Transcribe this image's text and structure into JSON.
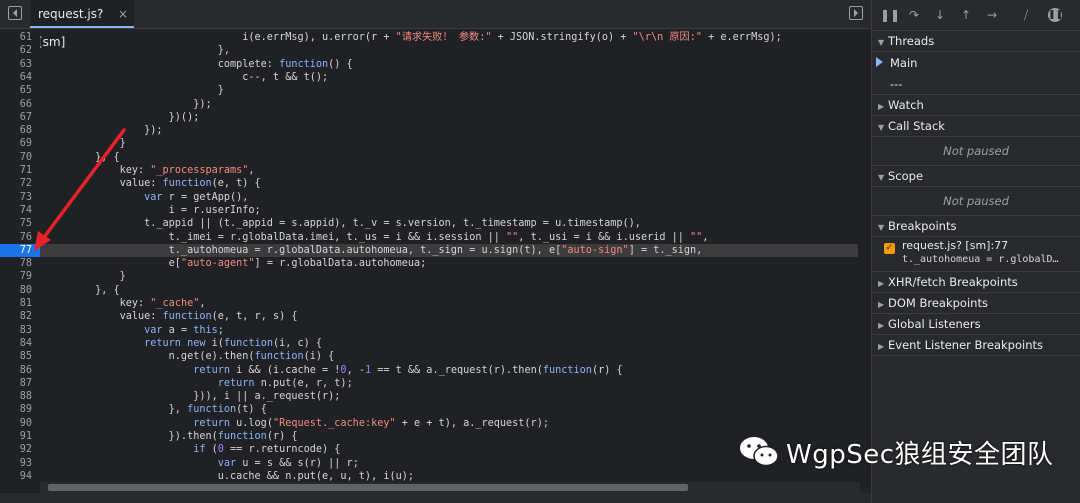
{
  "editor": {
    "tab_label": "request.js? [sm]",
    "close_label": "×",
    "breakpoint_line": "77"
  },
  "code_lines": [
    {
      "n": "61",
      "parts": [
        [
          "",
          "                                i(e.errMsg), u.error(r + "
        ],
        [
          "str",
          "\"请求失败！ 参数:\""
        ],
        [
          "",
          " + JSON.stringify(o) + "
        ],
        [
          "str",
          "\"\\r\\n 原因:\""
        ],
        [
          "",
          " + e.errMsg);"
        ]
      ]
    },
    {
      "n": "62",
      "parts": [
        [
          "",
          "                            },"
        ]
      ]
    },
    {
      "n": "63",
      "parts": [
        [
          "",
          "                            complete: "
        ],
        [
          "kw",
          "function"
        ],
        [
          "",
          "() {"
        ]
      ]
    },
    {
      "n": "64",
      "parts": [
        [
          "",
          "                                c--, t && t();"
        ]
      ]
    },
    {
      "n": "65",
      "parts": [
        [
          "",
          "                            }"
        ]
      ]
    },
    {
      "n": "66",
      "parts": [
        [
          "",
          "                        });"
        ]
      ]
    },
    {
      "n": "67",
      "parts": [
        [
          "",
          "                    })();"
        ]
      ]
    },
    {
      "n": "68",
      "parts": [
        [
          "",
          "                });"
        ]
      ]
    },
    {
      "n": "69",
      "parts": [
        [
          "",
          "            }"
        ]
      ]
    },
    {
      "n": "70",
      "parts": [
        [
          "",
          "        }, {"
        ]
      ]
    },
    {
      "n": "71",
      "parts": [
        [
          "",
          "            key: "
        ],
        [
          "str",
          "\"_processparams\""
        ],
        [
          "",
          ","
        ]
      ]
    },
    {
      "n": "72",
      "parts": [
        [
          "",
          "            value: "
        ],
        [
          "kw",
          "function"
        ],
        [
          "",
          "(e, t) {"
        ]
      ]
    },
    {
      "n": "73",
      "parts": [
        [
          "",
          "                "
        ],
        [
          "kw",
          "var"
        ],
        [
          "",
          " r = getApp(),"
        ]
      ]
    },
    {
      "n": "74",
      "parts": [
        [
          "",
          "                    i = r.userInfo;"
        ]
      ]
    },
    {
      "n": "75",
      "parts": [
        [
          "",
          "                t._appid || (t._appid = s.appid), t._v = s.version, t._timestamp = u.timestamp(),"
        ]
      ]
    },
    {
      "n": "76",
      "parts": [
        [
          "",
          "                    t._imei = r.globalData.imei, t._us = i && i.session || "
        ],
        [
          "str",
          "\"\""
        ],
        [
          "",
          ", t._usi = i && i.userid || "
        ],
        [
          "str",
          "\"\""
        ],
        [
          "",
          ","
        ]
      ]
    },
    {
      "n": "77",
      "parts": [
        [
          "",
          "                    t._autohomeua = r.globalData.autohomeua, t._sign = u.sign(t), e["
        ],
        [
          "str",
          "\"auto-sign\""
        ],
        [
          "",
          "] = t._sign,"
        ]
      ]
    },
    {
      "n": "78",
      "parts": [
        [
          "",
          "                    e["
        ],
        [
          "str",
          "\"auto-agent\""
        ],
        [
          "",
          "] = r.globalData.autohomeua;"
        ]
      ]
    },
    {
      "n": "79",
      "parts": [
        [
          "",
          "            }"
        ]
      ]
    },
    {
      "n": "80",
      "parts": [
        [
          "",
          "        }, {"
        ]
      ]
    },
    {
      "n": "81",
      "parts": [
        [
          "",
          "            key: "
        ],
        [
          "str",
          "\"_cache\""
        ],
        [
          "",
          ","
        ]
      ]
    },
    {
      "n": "82",
      "parts": [
        [
          "",
          "            value: "
        ],
        [
          "kw",
          "function"
        ],
        [
          "",
          "(e, t, r, s) {"
        ]
      ]
    },
    {
      "n": "83",
      "parts": [
        [
          "",
          "                "
        ],
        [
          "kw",
          "var"
        ],
        [
          "",
          " a = "
        ],
        [
          "kw",
          "this"
        ],
        [
          "",
          ";"
        ]
      ]
    },
    {
      "n": "84",
      "parts": [
        [
          "",
          "                "
        ],
        [
          "kw",
          "return"
        ],
        [
          "",
          " "
        ],
        [
          "kw",
          "new"
        ],
        [
          "",
          " i("
        ],
        [
          "kw",
          "function"
        ],
        [
          "",
          "(i, c) {"
        ]
      ]
    },
    {
      "n": "85",
      "parts": [
        [
          "",
          "                    n.get(e).then("
        ],
        [
          "kw",
          "function"
        ],
        [
          "",
          "(i) {"
        ]
      ]
    },
    {
      "n": "86",
      "parts": [
        [
          "",
          "                        "
        ],
        [
          "kw",
          "return"
        ],
        [
          "",
          " i && (i.cache = !"
        ],
        [
          "num",
          "0"
        ],
        [
          "",
          ", -"
        ],
        [
          "num",
          "1"
        ],
        [
          "",
          " == t && a._request(r).then("
        ],
        [
          "kw",
          "function"
        ],
        [
          "",
          "(r) {"
        ]
      ]
    },
    {
      "n": "87",
      "parts": [
        [
          "",
          "                            "
        ],
        [
          "kw",
          "return"
        ],
        [
          "",
          " n.put(e, r, t);"
        ]
      ]
    },
    {
      "n": "88",
      "parts": [
        [
          "",
          "                        })), i || a._request(r);"
        ]
      ]
    },
    {
      "n": "89",
      "parts": [
        [
          "",
          "                    }, "
        ],
        [
          "kw",
          "function"
        ],
        [
          "",
          "(t) {"
        ]
      ]
    },
    {
      "n": "90",
      "parts": [
        [
          "",
          "                        "
        ],
        [
          "kw",
          "return"
        ],
        [
          "",
          " u.log("
        ],
        [
          "str",
          "\"Request._cache:key\""
        ],
        [
          "",
          " + e + t), a._request(r);"
        ]
      ]
    },
    {
      "n": "91",
      "parts": [
        [
          "",
          "                    }).then("
        ],
        [
          "kw",
          "function"
        ],
        [
          "",
          "(r) {"
        ]
      ]
    },
    {
      "n": "92",
      "parts": [
        [
          "",
          "                        "
        ],
        [
          "kw",
          "if"
        ],
        [
          "",
          " ("
        ],
        [
          "num",
          "0"
        ],
        [
          "",
          " == r.returncode) {"
        ]
      ]
    },
    {
      "n": "93",
      "parts": [
        [
          "",
          "                            "
        ],
        [
          "kw",
          "var"
        ],
        [
          "",
          " u = s && s(r) || r;"
        ]
      ]
    },
    {
      "n": "94",
      "parts": [
        [
          "",
          "                            u.cache && n.put(e, u, t), i(u);"
        ]
      ]
    }
  ],
  "sidebar": {
    "threads": {
      "title": "Threads",
      "main": "Main",
      "other": "---"
    },
    "watch": {
      "title": "Watch"
    },
    "call_stack": {
      "title": "Call Stack",
      "empty": "Not paused"
    },
    "scope": {
      "title": "Scope",
      "empty": "Not paused"
    },
    "breakpoints": {
      "title": "Breakpoints",
      "item_name": "request.js? [sm]:77",
      "item_code": "t._autohomeua = r.globalD…"
    },
    "xhr": {
      "title": "XHR/fetch Breakpoints"
    },
    "dom": {
      "title": "DOM Breakpoints"
    },
    "global": {
      "title": "Global Listeners"
    },
    "event": {
      "title": "Event Listener Breakpoints"
    }
  },
  "watermark": {
    "text": "WgpSec狼组安全团队"
  },
  "colors": {
    "accent": "#1a73e8",
    "arrow": "#e8222a",
    "checkbox": "#f29900"
  }
}
